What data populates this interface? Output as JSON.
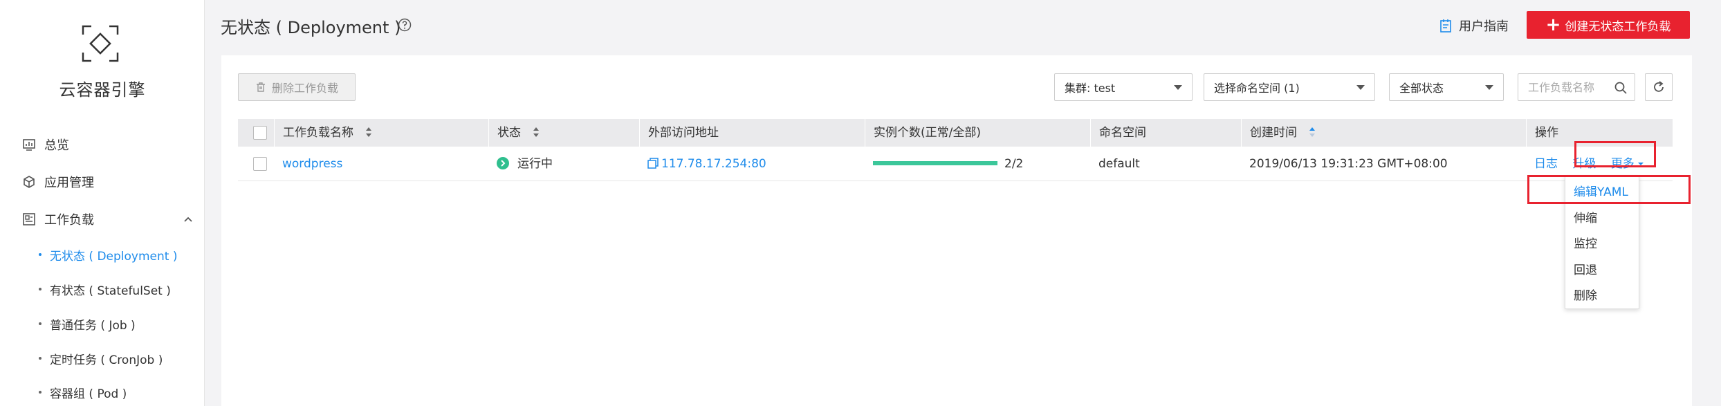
{
  "sidebar": {
    "title": "云容器引擎",
    "nav": [
      {
        "label": "总览",
        "icon": "dashboard-icon"
      },
      {
        "label": "应用管理",
        "icon": "cube-icon"
      },
      {
        "label": "工作负载",
        "icon": "workload-icon"
      }
    ],
    "sub_items": [
      {
        "label": "无状态 ( Deployment )",
        "active": true
      },
      {
        "label": "有状态 ( StatefulSet )",
        "active": false
      },
      {
        "label": "普通任务 ( Job )",
        "active": false
      },
      {
        "label": "定时任务 ( CronJob )",
        "active": false
      },
      {
        "label": "容器组 ( Pod )",
        "active": false
      }
    ]
  },
  "header": {
    "title": "无状态 ( Deployment )",
    "guide_label": "用户指南",
    "create_label": "创建无状态工作负载"
  },
  "toolbar": {
    "delete_label": "删除工作负载",
    "cluster_select": "集群:  test",
    "namespace_select": "选择命名空间 (1)",
    "status_select": "全部状态",
    "search_placeholder": "工作负载名称"
  },
  "table": {
    "columns": [
      "工作负载名称",
      "状态",
      "外部访问地址",
      "实例个数(正常/全部)",
      "命名空间",
      "创建时间",
      "操作"
    ],
    "rows": [
      {
        "name": "wordpress",
        "status": "运行中",
        "address": "117.78.17.254:80",
        "instances_text": "2/2",
        "instances_ratio": 1.0,
        "namespace": "default",
        "created": "2019/06/13 19:31:23 GMT+08:00",
        "actions": [
          "日志",
          "升级",
          "更多"
        ]
      }
    ]
  },
  "more_menu": [
    "编辑YAML",
    "伸缩",
    "监控",
    "回退",
    "删除"
  ],
  "colors": {
    "accent": "#1f8ceb",
    "danger": "#e8222f",
    "success": "#2fbf8e"
  }
}
